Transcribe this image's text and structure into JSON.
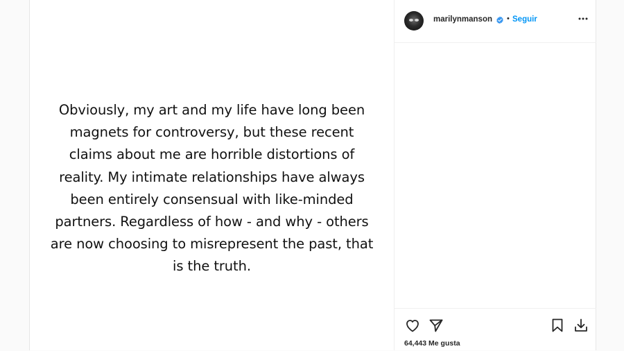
{
  "post": {
    "body_lines": [
      "Obviously, my art and my life have long been",
      "magnets for controversy, but these recent",
      "claims about me are horrible distortions of",
      "reality. My intimate relationships have always",
      "been entirely consensual with like-minded",
      "partners. Regardless of how - and why - others",
      "are now choosing to misrepresent the past, that",
      "is the truth."
    ]
  },
  "header": {
    "username": "marilynmanson",
    "separator": "•",
    "follow_label": "Seguir",
    "verified_icon": "verified-badge-icon",
    "more_icon": "more-options-icon"
  },
  "actions": {
    "like_icon": "heart-icon",
    "share_icon": "send-icon",
    "save_icon": "bookmark-icon",
    "download_icon": "download-icon",
    "likes_text": "64,443 Me gusta"
  },
  "colors": {
    "accent": "#0095f6",
    "text": "#262626",
    "border": "#efefef"
  }
}
